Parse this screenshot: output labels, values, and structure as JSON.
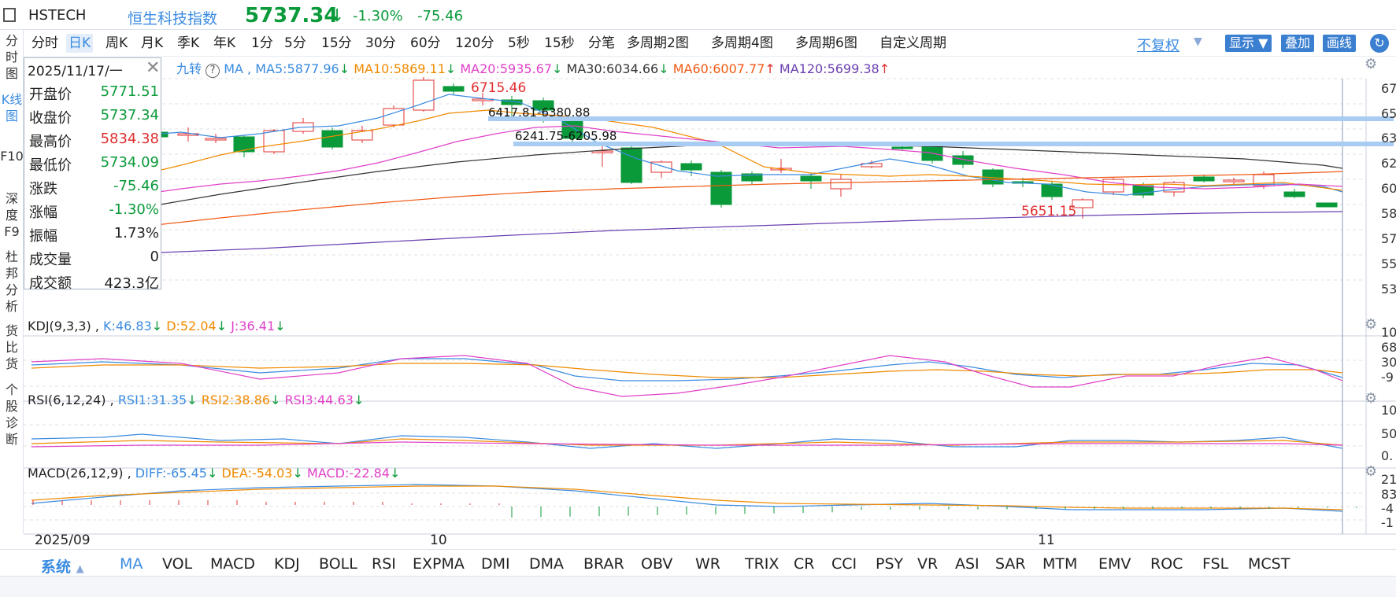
{
  "header": {
    "code": "HSTECH",
    "name": "恒生科技指数",
    "price": "5737.34",
    "arrow": "↓",
    "change_pct": "-1.30%",
    "change": "-75.46"
  },
  "sidebar": [
    "分时图",
    "K线图",
    "F10",
    "深度F9",
    "杜邦分析",
    "货比货",
    "个股诊断"
  ],
  "periods": [
    "分时",
    "日K",
    "周K",
    "月K",
    "季K",
    "年K",
    "1分",
    "5分",
    "15分",
    "30分",
    "60分",
    "120分",
    "5秒",
    "15秒",
    "分笔",
    "多周期2图",
    "多周期4图",
    "多周期6图",
    "自定义周期"
  ],
  "right_controls": {
    "adjust": "不复权",
    "show": "显示",
    "overlay": "叠加",
    "draw": "画线"
  },
  "ma_line": {
    "prefix": "九转",
    "ma": "MA ,",
    "ma5": "MA5:5877.96",
    "ma10": "MA10:5869.11",
    "ma20": "MA20:5935.67",
    "ma30": "MA30:6034.66",
    "ma60": "MA60:6007.77",
    "ma120": "MA120:5699.38",
    "down": "↓",
    "up": "↑"
  },
  "infobox": {
    "date": "2025/11/17/一",
    "rows": [
      {
        "label": "开盘价",
        "value": "5771.51",
        "color": "#0a9a3a"
      },
      {
        "label": "收盘价",
        "value": "5737.34",
        "color": "#0a9a3a"
      },
      {
        "label": "最高价",
        "value": "5834.38",
        "color": "#e03030"
      },
      {
        "label": "最低价",
        "value": "5734.09",
        "color": "#0a9a3a"
      },
      {
        "label": "涨跌",
        "value": "-75.46",
        "color": "#0a9a3a"
      },
      {
        "label": "涨幅",
        "value": "-1.30%",
        "color": "#0a9a3a"
      },
      {
        "label": "振幅",
        "value": "1.73%",
        "color": "#222222"
      },
      {
        "label": "成交量",
        "value": "0",
        "color": "#222222"
      },
      {
        "label": "成交额",
        "value": "423.3亿",
        "color": "#222222"
      }
    ]
  },
  "annotations": {
    "high": "6715.46",
    "low": "5651.15",
    "gap1": "6417.81-6380.88",
    "gap2": "6241.75-6205.98"
  },
  "price_axis": [
    "67",
    "65",
    "63",
    "62",
    "60",
    "58",
    "57",
    "55",
    "53"
  ],
  "kdj": {
    "title": "KDJ(9,3,3) ,",
    "k": "K:46.83",
    "d": "D:52.04",
    "j": "J:36.41",
    "axis": [
      "10",
      "68",
      "30",
      "-9"
    ]
  },
  "rsi": {
    "title": "RSI(6,12,24) ,",
    "r1": "RSI1:31.35",
    "r2": "RSI2:38.86",
    "r3": "RSI3:44.63",
    "axis": [
      "10",
      "50",
      "0."
    ]
  },
  "macd": {
    "title": "MACD(26,12,9) ,",
    "diff": "DIFF:-65.45",
    "dea": "DEA:-54.03",
    "macd": "MACD:-22.84",
    "axis": [
      "21",
      "83",
      "-4",
      "-1"
    ]
  },
  "x_axis": [
    "2025/09",
    "10",
    "11"
  ],
  "bottom_tabs": [
    "系统",
    "MA",
    "VOL",
    "MACD",
    "KDJ",
    "BOLL",
    "RSI",
    "EXPMA",
    "DMI",
    "DMA",
    "BRAR",
    "OBV",
    "WR",
    "TRIX",
    "CR",
    "CCI",
    "PSY",
    "VR",
    "ASI",
    "SAR",
    "MTM",
    "EMV",
    "ROC",
    "FSL",
    "MCST"
  ],
  "colors": {
    "up": "#e03030",
    "down": "#0a9a3a",
    "accent": "#3a8be0",
    "ma5": "#3a8be0",
    "ma10": "#f08a00",
    "ma20": "#e040c8",
    "ma30": "#333333",
    "ma60": "#f05a14",
    "ma120": "#6a3fb0"
  }
}
